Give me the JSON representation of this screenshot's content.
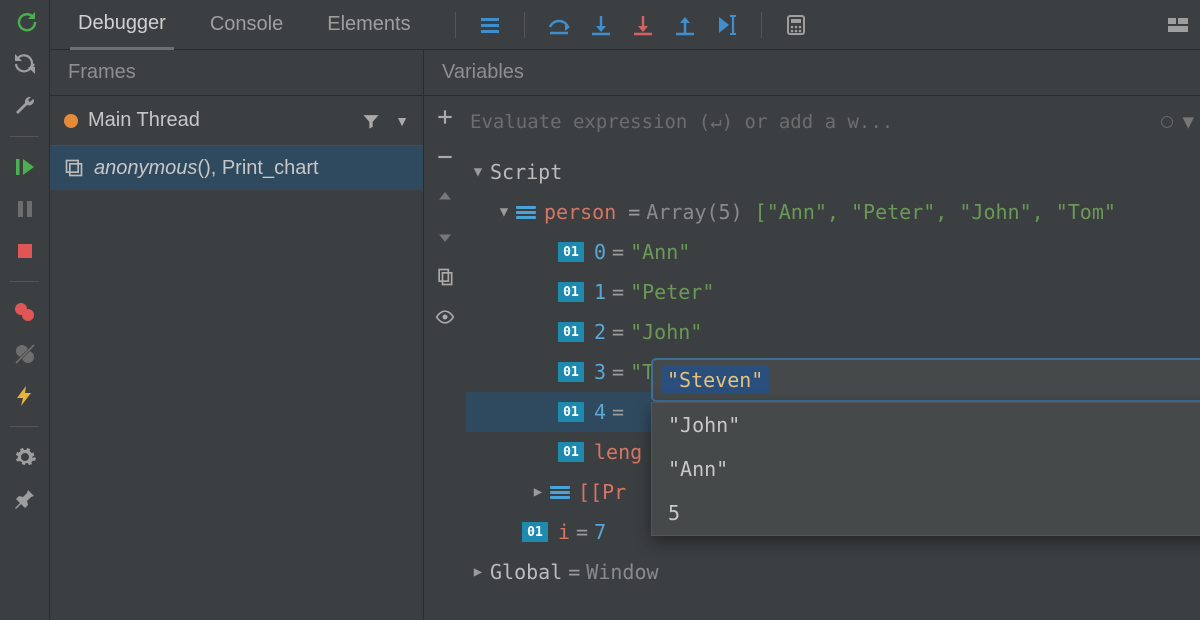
{
  "tabs": {
    "debugger": "Debugger",
    "console": "Console",
    "elements": "Elements"
  },
  "frames": {
    "header": "Frames",
    "thread": "Main Thread",
    "stack_fn": "anonymous",
    "stack_suffix": "(), Print_chart"
  },
  "variables": {
    "header": "Variables",
    "eval_placeholder": "Evaluate expression (↵) or add a w...",
    "script_label": "Script",
    "person": {
      "name": "person",
      "type": "Array(5)",
      "preview": "[\"Ann\", \"Peter\", \"John\", \"Tom\"",
      "items": [
        {
          "idx": "0",
          "val": "\"Ann\""
        },
        {
          "idx": "1",
          "val": "\"Peter\""
        },
        {
          "idx": "2",
          "val": "\"John\""
        },
        {
          "idx": "3",
          "val": "\"Tom\""
        },
        {
          "idx": "4",
          "val": "\"Steven\""
        }
      ],
      "length_label": "leng",
      "proto_label": "[[Pr"
    },
    "i_var": {
      "name": "i",
      "val": "7"
    },
    "global": {
      "name": "Global",
      "val": "Window"
    },
    "editor": {
      "value": "\"Steven\"",
      "suggestions": [
        "\"John\"",
        "\"Ann\"",
        "5"
      ]
    }
  },
  "badges": {
    "oi": "01"
  }
}
